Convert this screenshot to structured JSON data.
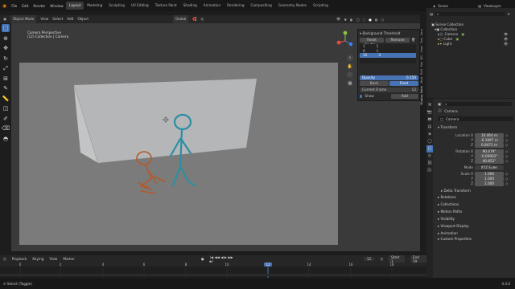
{
  "topbar": {
    "menus": [
      "File",
      "Edit",
      "Render",
      "Window",
      "Help"
    ],
    "workspaces": [
      "Layout",
      "Modeling",
      "Sculpting",
      "UV Editing",
      "Texture Paint",
      "Shading",
      "Animation",
      "Rendering",
      "Compositing",
      "Geometry Nodes",
      "Scripting"
    ],
    "active_workspace": "Layout",
    "scene": "Scene",
    "view_layer": "ViewLayer"
  },
  "viewport_header": {
    "mode": "Object Mode",
    "menus": [
      "View",
      "Select",
      "Add",
      "Object"
    ],
    "orientation": "Global"
  },
  "camera_info": {
    "line1": "Camera Perspective",
    "line2": "(12) Collection | Camera"
  },
  "npanel": {
    "title": "Background Threshold",
    "reset_label": "Reset Keyfra...",
    "remove_label": "Remove",
    "rows": [
      {
        "a": "1",
        "b": "1"
      },
      {
        "a": "6",
        "b": "1"
      },
      {
        "a": "12",
        "b": "3"
      }
    ],
    "opacity_label": "Opacity",
    "opacity_value": "0.150",
    "back_label": "Back",
    "front_label": "Front",
    "current_frame_label": "Current Frame",
    "current_frame_value": "12",
    "show_label": "Show",
    "add_label": "Add"
  },
  "sidetabs": [
    "Item",
    "Tool",
    "View",
    "BG",
    "Fab",
    "Edit",
    "Mod",
    "Display Setts"
  ],
  "outliner": {
    "search": "",
    "items": [
      {
        "label": "Scene Collection"
      },
      {
        "label": "Collection"
      },
      {
        "label": "Camera"
      },
      {
        "label": "Cube"
      },
      {
        "label": "Light"
      }
    ]
  },
  "properties": {
    "object_name": "Camera",
    "data_name": "Camera",
    "transform_label": "Transform",
    "location": {
      "label": "Location X",
      "x": "10.464 m",
      "y": "-6.1997 m",
      "z": "0.8472 m"
    },
    "rotation": {
      "label": "Rotation X",
      "x": "90.479°",
      "y": "-0.00002°",
      "z": "40.852°"
    },
    "mode_label": "Mode",
    "mode_value": "XYZ Euler",
    "scale": {
      "label": "Scale X",
      "x": "1.000",
      "y": "1.000",
      "z": "1.000"
    },
    "sections": [
      "Delta Transform",
      "Relations",
      "Collections",
      "Motion Paths",
      "Visibility",
      "Viewport Display",
      "Animation",
      "Custom Properties"
    ],
    "yz": [
      "Y",
      "Z"
    ]
  },
  "timeline": {
    "menus": [
      "Playback",
      "Keying",
      "View",
      "Marker"
    ],
    "current_frame": "12",
    "start": "1",
    "end": "19",
    "ticks": [
      "1",
      "3",
      "5",
      "7",
      "9",
      "11",
      "13",
      "15",
      "17",
      "19"
    ],
    "frame_numbers": [
      "0",
      "2",
      "4",
      "6",
      "8",
      "10",
      "12",
      "14",
      "16",
      "18"
    ]
  },
  "status": {
    "left": "Select (Toggle)",
    "version": "4.4.0"
  }
}
